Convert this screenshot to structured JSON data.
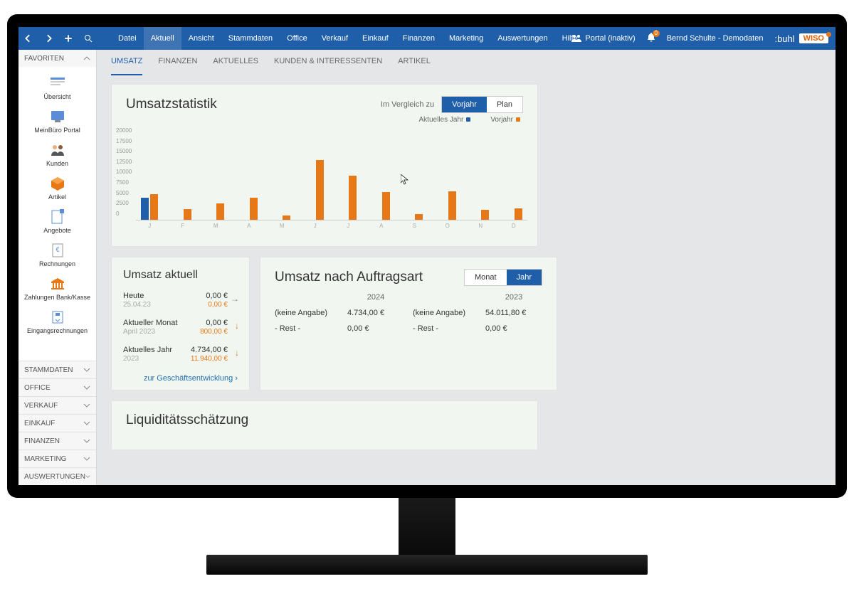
{
  "titlebar": {
    "menu": [
      "Datei",
      "Aktuell",
      "Ansicht",
      "Stammdaten",
      "Office",
      "Verkauf",
      "Einkauf",
      "Finanzen",
      "Marketing",
      "Auswertungen",
      "Hilfe"
    ],
    "menu_active": 1,
    "portal": "Portal (inaktiv)",
    "user": "Bernd Schulte - Demodaten",
    "brand1": ":buhl",
    "brand2": "WISO"
  },
  "sidebar": {
    "head": "FAVORITEN",
    "favs": [
      {
        "label": "Übersicht",
        "icon": "overview"
      },
      {
        "label": "MeinBüro Portal",
        "icon": "portal"
      },
      {
        "label": "Kunden",
        "icon": "people"
      },
      {
        "label": "Artikel",
        "icon": "box"
      },
      {
        "label": "Angebote",
        "icon": "offer"
      },
      {
        "label": "Rechnungen",
        "icon": "invoice"
      },
      {
        "label": "Zahlungen Bank/Kasse",
        "icon": "bank"
      },
      {
        "label": "Eingangsrechnungen",
        "icon": "inbox"
      }
    ],
    "sections": [
      "STAMMDATEN",
      "OFFICE",
      "VERKAUF",
      "EINKAUF",
      "FINANZEN",
      "MARKETING",
      "AUSWERTUNGEN"
    ]
  },
  "tabs": {
    "items": [
      "UMSATZ",
      "FINANZEN",
      "AKTUELLES",
      "KUNDEN & INTERESSENTEN",
      "ARTIKEL"
    ],
    "active": 0
  },
  "stats": {
    "title": "Umsatzstatistik",
    "compare_label": "Im Vergleich zu",
    "compare_opts": [
      "Vorjahr",
      "Plan"
    ],
    "compare_active": 0,
    "legend_current": "Aktuelles Jahr",
    "legend_prev": "Vorjahr"
  },
  "chart_data": {
    "type": "bar",
    "categories": [
      "J",
      "F",
      "M",
      "A",
      "M",
      "J",
      "J",
      "A",
      "S",
      "O",
      "N",
      "D"
    ],
    "series": [
      {
        "name": "Aktuelles Jahr",
        "values": [
          4734,
          0,
          0,
          0,
          0,
          0,
          0,
          0,
          0,
          0,
          0,
          0
        ]
      },
      {
        "name": "Vorjahr",
        "values": [
          5500,
          2300,
          3500,
          4800,
          900,
          13000,
          9500,
          6000,
          1200,
          6200,
          2200,
          2400
        ]
      }
    ],
    "ylabel": "",
    "xlabel": "",
    "ylim": [
      0,
      20000
    ],
    "yticks": [
      20000,
      17500,
      15000,
      12500,
      10000,
      7500,
      5000,
      2500,
      0
    ]
  },
  "aktuell": {
    "title": "Umsatz aktuell",
    "rows": [
      {
        "l1": "Heute",
        "l2": "25.04.23",
        "r1": "0,00 €",
        "r2": "0,00 €",
        "arrow": "gray"
      },
      {
        "l1": "Aktueller Monat",
        "l2": "April 2023",
        "r1": "0,00 €",
        "r2": "800,00 €",
        "arrow": "down"
      },
      {
        "l1": "Aktuelles Jahr",
        "l2": "2023",
        "r1": "4.734,00 €",
        "r2": "11.940,00 €",
        "arrow": "down"
      }
    ],
    "link": "zur Geschäftsentwicklung  ›"
  },
  "auftragsart": {
    "title": "Umsatz nach Auftragsart",
    "opts": [
      "Monat",
      "Jahr"
    ],
    "active": 1,
    "head1": "2024",
    "head2": "2023",
    "rows": [
      {
        "a": "(keine Angabe)",
        "b": "4.734,00 €",
        "c": "(keine Angabe)",
        "d": "54.011,80 €"
      },
      {
        "a": "- Rest -",
        "b": "0,00 €",
        "c": "- Rest -",
        "d": "0,00 €"
      }
    ]
  },
  "liquid": {
    "title": "Liquiditätsschätzung"
  }
}
